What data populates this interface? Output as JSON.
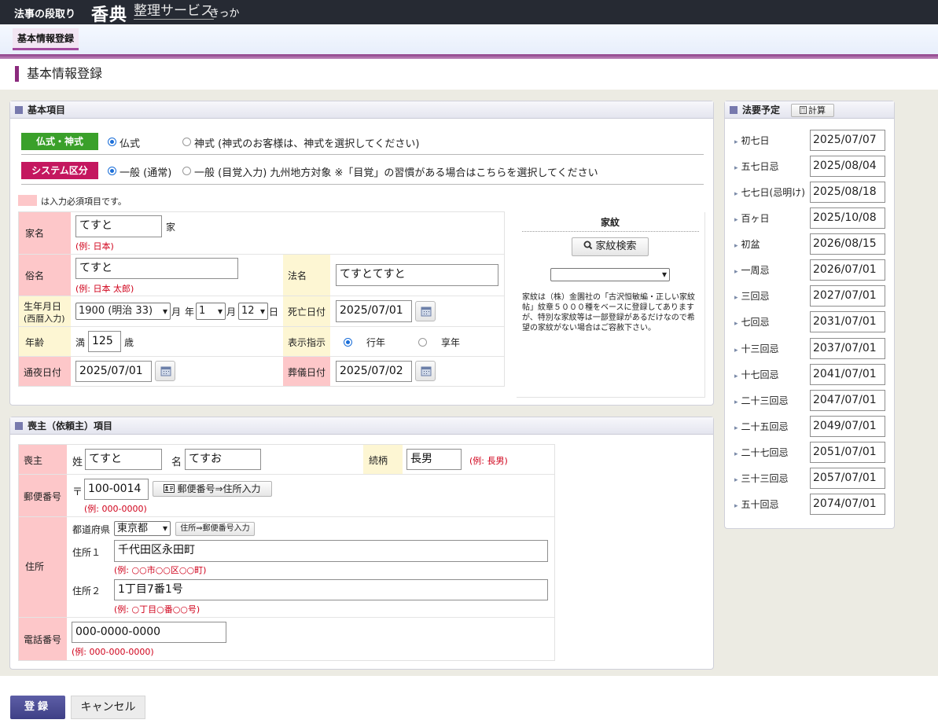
{
  "header": {
    "brand_line1": "法事の段取り",
    "brand_kouden": "香典",
    "brand_service": "整理サービス",
    "brand_kikka": "きっか",
    "tab_label": "基本情報登録"
  },
  "page": {
    "title": "基本情報登録"
  },
  "basic": {
    "section_title": "基本項目",
    "buddhism_tag": "仏式・神式",
    "buddhism_option": "仏式",
    "shinto_option": "神式 (神式のお客様は、神式を選択してください)",
    "system_tag": "システム区分",
    "system_normal": "一般 (通常)",
    "system_mezame": "一般 (目覚入力) 九州地方対象 ※「目覚」の習慣がある場合はこちらを選択してください",
    "required_note": "は入力必須項目です。",
    "family_name_label": "家名",
    "family_name_value": "てすと",
    "family_suffix": "家",
    "family_name_example": "(例: 日本)",
    "common_name_label": "俗名",
    "common_name_value": "てすと",
    "common_name_example": "(例: 日本 太郎)",
    "dharma_name_label": "法名",
    "dharma_name_value": "てすとてすと",
    "birth_label": "生年月日",
    "birth_sub": "(西暦入力)",
    "birth_year": "1900 (明治 33)",
    "birth_month_suffix": "月",
    "birth_year_suffix": "年",
    "birth_month": "1",
    "birth_month_suffix2": "月",
    "birth_day": "12",
    "birth_day_suffix": "日",
    "death_label": "死亡日付",
    "death_value": "2025/07/01",
    "age_label": "年齢",
    "age_prefix": "満",
    "age_value": "125",
    "age_suffix": "歳",
    "display_label": "表示指示",
    "display_gyonen": "行年",
    "display_kyonen": "享年",
    "wake_label": "通夜日付",
    "wake_value": "2025/07/01",
    "funeral_label": "葬儀日付",
    "funeral_value": "2025/07/02"
  },
  "kamon": {
    "title": "家紋",
    "search_button": "家紋検索",
    "selected": "",
    "note": "家紋は（株）金園社の「古沢恒敏編・正しい家紋帖」紋章５０００種をベースに登録してありますが、特別な家紋等は一部登録があるだけなので希望の家紋がない場合はご容赦下さい。"
  },
  "mourner": {
    "section_title": "喪主（依頼主）項目",
    "mourner_label": "喪主",
    "last_label": "姓",
    "last_value": "てすと",
    "first_label": "名",
    "first_value": "てすお",
    "relation_label": "続柄",
    "relation_value": "長男",
    "relation_example": "(例: 長男)",
    "postal_label": "郵便番号",
    "postal_mark": "〒",
    "postal_value": "100-0014",
    "postal_button": "郵便番号⇒住所入力",
    "postal_example": "(例: 000-0000)",
    "address_label": "住所",
    "prefecture_label": "都道府県",
    "prefecture_value": "東京都",
    "pref_button": "住所⇒郵便番号入力",
    "address1_label": "住所１",
    "address1_value": "千代田区永田町",
    "address1_example": "(例: ○○市○○区○○町)",
    "address2_label": "住所２",
    "address2_value": "1丁目7番1号",
    "address2_example": "(例: ○丁目○番○○号)",
    "phone_label": "電話番号",
    "phone_value": "000-0000-0000",
    "phone_example": "(例: 000-000-0000)"
  },
  "hoyo": {
    "section_title": "法要予定",
    "calc_button": "計算",
    "items": [
      {
        "label": "初七日",
        "date": "2025/07/07"
      },
      {
        "label": "五七日忌",
        "date": "2025/08/04"
      },
      {
        "label": "七七日(忌明け)",
        "date": "2025/08/18"
      },
      {
        "label": "百ヶ日",
        "date": "2025/10/08"
      },
      {
        "label": "初盆",
        "date": "2026/08/15"
      },
      {
        "label": "一周忌",
        "date": "2026/07/01"
      },
      {
        "label": "三回忌",
        "date": "2027/07/01"
      },
      {
        "label": "七回忌",
        "date": "2031/07/01"
      },
      {
        "label": "十三回忌",
        "date": "2037/07/01"
      },
      {
        "label": "十七回忌",
        "date": "2041/07/01"
      },
      {
        "label": "二十三回忌",
        "date": "2047/07/01"
      },
      {
        "label": "二十五回忌",
        "date": "2049/07/01"
      },
      {
        "label": "二十七回忌",
        "date": "2051/07/01"
      },
      {
        "label": "三十三回忌",
        "date": "2057/07/01"
      },
      {
        "label": "五十回忌",
        "date": "2074/07/01"
      }
    ]
  },
  "actions": {
    "register": "登録",
    "cancel": "キャンセル"
  },
  "colors": {
    "green_tag": "#3aa02a",
    "magenta_tag": "#c4175f",
    "required_pink": "#fdc7c9",
    "optional_yellow": "#fdf6d3",
    "primary_button": "#4a4b93"
  }
}
